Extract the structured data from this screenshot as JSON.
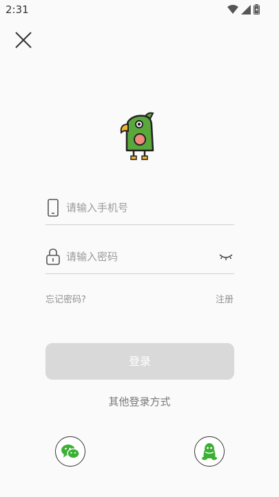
{
  "status_bar": {
    "time": "2:31",
    "icons": [
      "wifi-icon",
      "signal-icon",
      "battery-icon"
    ]
  },
  "header": {
    "close_icon": "close-icon"
  },
  "logo": {
    "icon": "parrot-logo-icon",
    "colors": {
      "body": "#5aa83c",
      "beak": "#f2b632",
      "cheek": "#ef8a7d"
    }
  },
  "form": {
    "phone": {
      "placeholder": "请输入手机号",
      "value": "",
      "icon": "phone-icon"
    },
    "password": {
      "placeholder": "请输入密码",
      "value": "",
      "icon": "lock-icon",
      "toggle_icon": "eye-closed-icon"
    },
    "forgot_password": "忘记密码?",
    "register": "注册",
    "login_button": "登录"
  },
  "other_login": {
    "label": "其他登录方式",
    "providers": [
      {
        "name": "wechat",
        "icon": "wechat-icon",
        "color": "#3cb034"
      },
      {
        "name": "qq",
        "icon": "qq-icon",
        "color": "#3cb034"
      }
    ]
  },
  "colors": {
    "button_disabled": "#d9d9d9",
    "divider": "#cfcfcf",
    "placeholder": "#9a9a9a"
  }
}
